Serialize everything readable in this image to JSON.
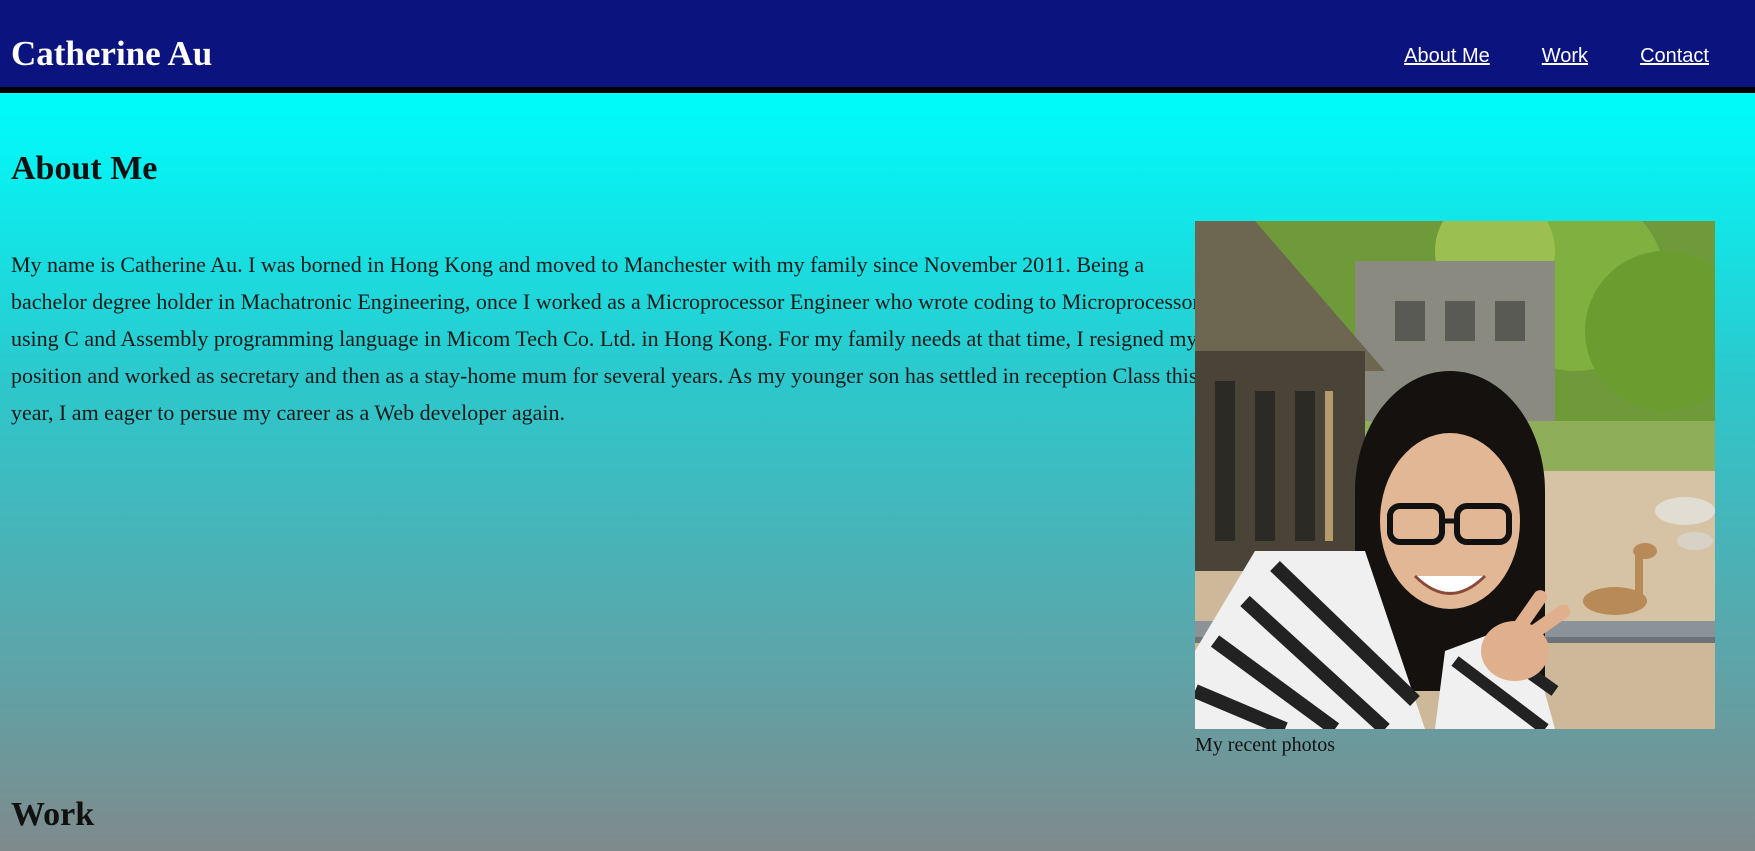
{
  "header": {
    "title": "Catherine Au",
    "nav": [
      {
        "label": "About Me"
      },
      {
        "label": "Work"
      },
      {
        "label": "Contact"
      }
    ]
  },
  "about": {
    "heading": "About Me",
    "paragraph": "My name is Catherine Au. I was borned in Hong Kong and moved to Manchester with my family since November 2011. Being a bachelor degree holder in Machatronic Engineering, once I worked as a Microprocessor Engineer who wrote coding to Microprocessor using C and Assembly programming language in Micom Tech Co. Ltd. in Hong Kong. For my family needs at that time, I resigned my position and worked as secretary and then as a stay-home mum for several years. As my younger son has settled in reception Class this year, I am eager to persue my career as a Web developer again.",
    "photo_caption": "My recent photos"
  },
  "work": {
    "heading": "Work"
  },
  "colors": {
    "header_bg": "#0b137e",
    "header_border": "#000000",
    "gradient_top": "#00ffff",
    "gradient_bottom": "#7f8a8c"
  }
}
